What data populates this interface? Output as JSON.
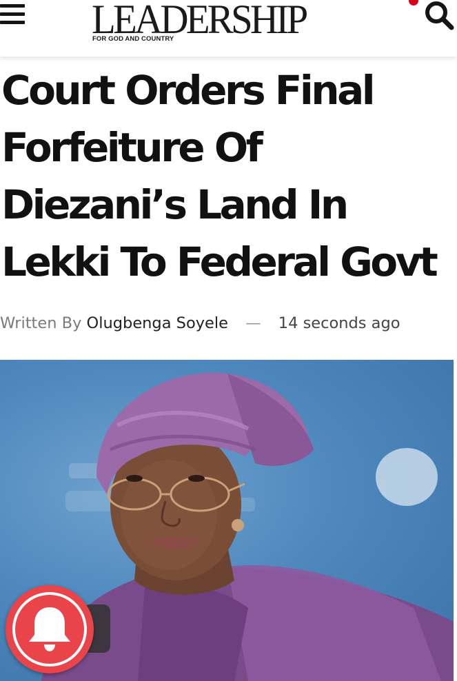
{
  "header": {
    "menu_icon": "hamburger-menu-icon",
    "logo": {
      "word": "LEADERSHIP",
      "tagline": "FOR GOD AND COUNTRY"
    },
    "search_icon": "search-icon",
    "accent_color": "#d6001c"
  },
  "article": {
    "headline": "Court Orders Final Forfeiture Of Diezani’s Land In Lekki To Federal Govt",
    "byline": {
      "prefix": "Written By",
      "author": "Olugbenga Soyele",
      "separator": "—",
      "time": "14 seconds ago"
    },
    "featured_image": "photo of a woman in a purple headwrap wearing glasses"
  },
  "notification": {
    "icon": "bell-icon",
    "color": "#e8444a"
  }
}
